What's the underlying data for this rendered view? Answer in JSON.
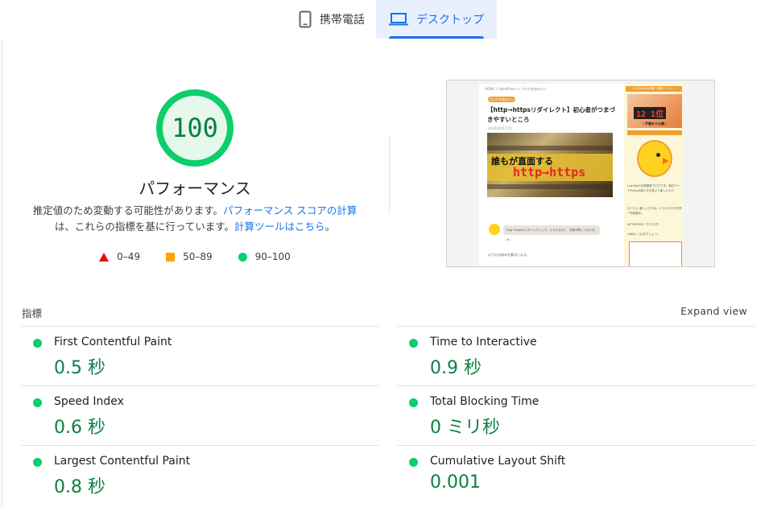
{
  "tabs": {
    "mobile_label": "携帯電話",
    "desktop_label": "デスクトップ"
  },
  "score": {
    "value": "100",
    "title": "パフォーマンス",
    "desc_prefix": "推定値のため変動する可能性があります。",
    "desc_link1": "パフォーマンス スコアの計算",
    "desc_middle": "は、これらの指標を基に行っています。",
    "desc_link2": "計算ツールはこちら",
    "desc_suffix": "。",
    "color": "#0cce6b"
  },
  "legend": [
    {
      "range": "0–49",
      "shape": "triangle",
      "color": "#eb0f00"
    },
    {
      "range": "50–89",
      "shape": "square",
      "color": "#ffa400"
    },
    {
      "range": "90–100",
      "shape": "circle",
      "color": "#0cce6b"
    }
  ],
  "thumbnail": {
    "breadcrumbs": "HOME > WordPress > ブログを始めたい",
    "tag": "ブログを始めたい",
    "article_title": "【http→httpsリダイレクト】初心者がつまづきやすいところ",
    "date": "2019年6月17日",
    "hero_line1": "誰もが直面する",
    "hero_line2": "http→https",
    "bubble_text": "http→httpsのリダイレクトって、どうやるの？　失敗が怖くてなかなか…",
    "intro_text": "以下のお悩みを解決します。",
    "sidebar_header": "ATFIDAODA特典（無料ツール）",
    "sidebar_rank": "12 1位",
    "sidebar_caption": "＼手順を大公開／",
    "sidebar_profile_text": "LuanNoの日常運営ブログです。毎日ワードPressの使い方を書いて楽しい人だ",
    "sidebar_item1": "ひーたい 楽しいですね。２つのブログを同一的運営中。",
    "sidebar_item2": "WTFNODOS（ホブログ）",
    "sidebar_item3": "GWALL（公式でしょ～）"
  },
  "metrics": {
    "heading": "指標",
    "expand_label": "Expand view",
    "items": [
      {
        "label": "First Contentful Paint",
        "value": "0.5 秒",
        "status_color": "#0cce6b"
      },
      {
        "label": "Time to Interactive",
        "value": "0.9 秒",
        "status_color": "#0cce6b"
      },
      {
        "label": "Speed Index",
        "value": "0.6 秒",
        "status_color": "#0cce6b"
      },
      {
        "label": "Total Blocking Time",
        "value": "0 ミリ秒",
        "status_color": "#0cce6b"
      },
      {
        "label": "Largest Contentful Paint",
        "value": "0.8 秒",
        "status_color": "#0cce6b"
      },
      {
        "label": "Cumulative Layout Shift",
        "value": "0.001",
        "status_color": "#0cce6b"
      }
    ]
  }
}
